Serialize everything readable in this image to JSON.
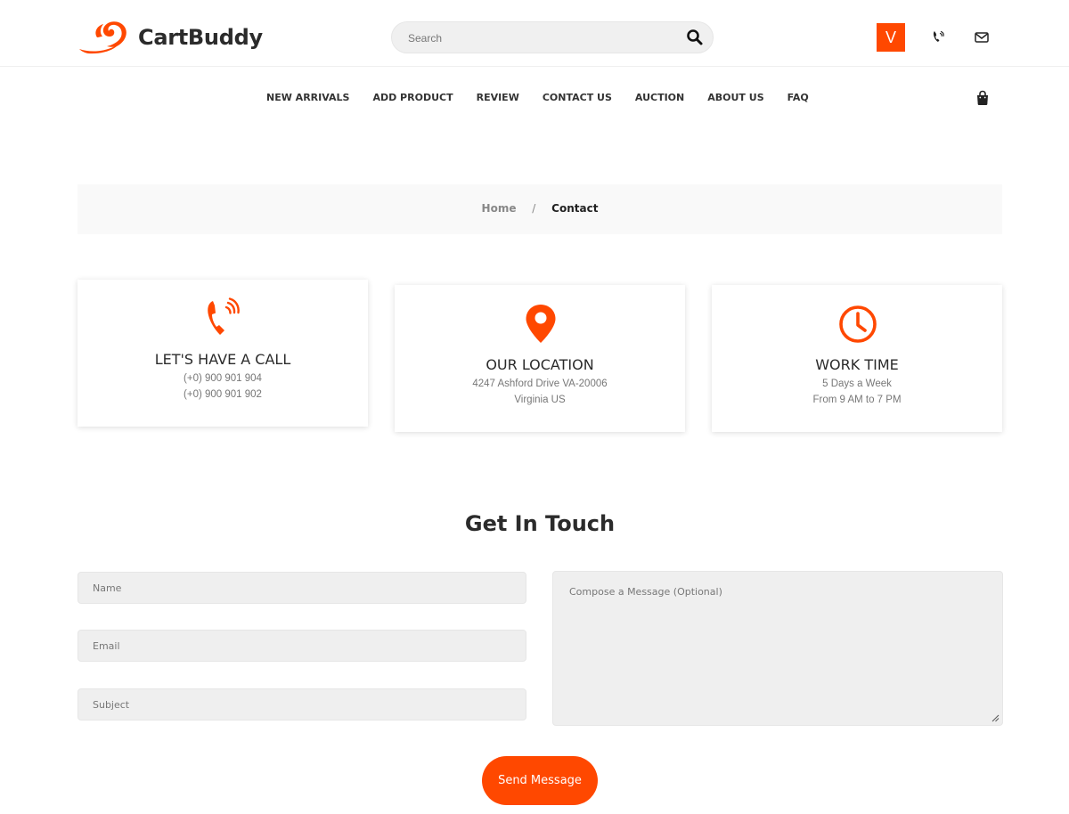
{
  "brand": {
    "name": "CartBuddy",
    "accent_color": "#ff4800"
  },
  "header": {
    "search_placeholder": "Search",
    "avatar_initial": "V",
    "icons": [
      "search-icon",
      "phone-icon",
      "mail-icon"
    ]
  },
  "nav": {
    "items": [
      "NEW ARRIVALS",
      "ADD PRODUCT",
      "REVIEW",
      "CONTACT US",
      "AUCTION",
      "ABOUT US",
      "FAQ"
    ],
    "cart_icon": "shopping-bag-icon"
  },
  "breadcrumb": {
    "home": "Home",
    "separator": "/",
    "current": "Contact"
  },
  "info_cards": [
    {
      "icon": "phone-ringing-icon",
      "title": "LET'S HAVE A CALL",
      "line1": "(+0) 900 901 904",
      "line2": "(+0) 900 901 902"
    },
    {
      "icon": "location-pin-icon",
      "title": "OUR LOCATION",
      "line1": "4247 Ashford Drive VA-20006",
      "line2": "Virginia US"
    },
    {
      "icon": "clock-icon",
      "title": "WORK TIME",
      "line1": "5 Days a Week",
      "line2": "From 9 AM to 7 PM"
    }
  ],
  "form": {
    "title": "Get In Touch",
    "name_placeholder": "Name",
    "email_placeholder": "Email",
    "subject_placeholder": "Subject",
    "message_placeholder": "Compose a Message (Optional)",
    "submit_label": "Send Message"
  }
}
